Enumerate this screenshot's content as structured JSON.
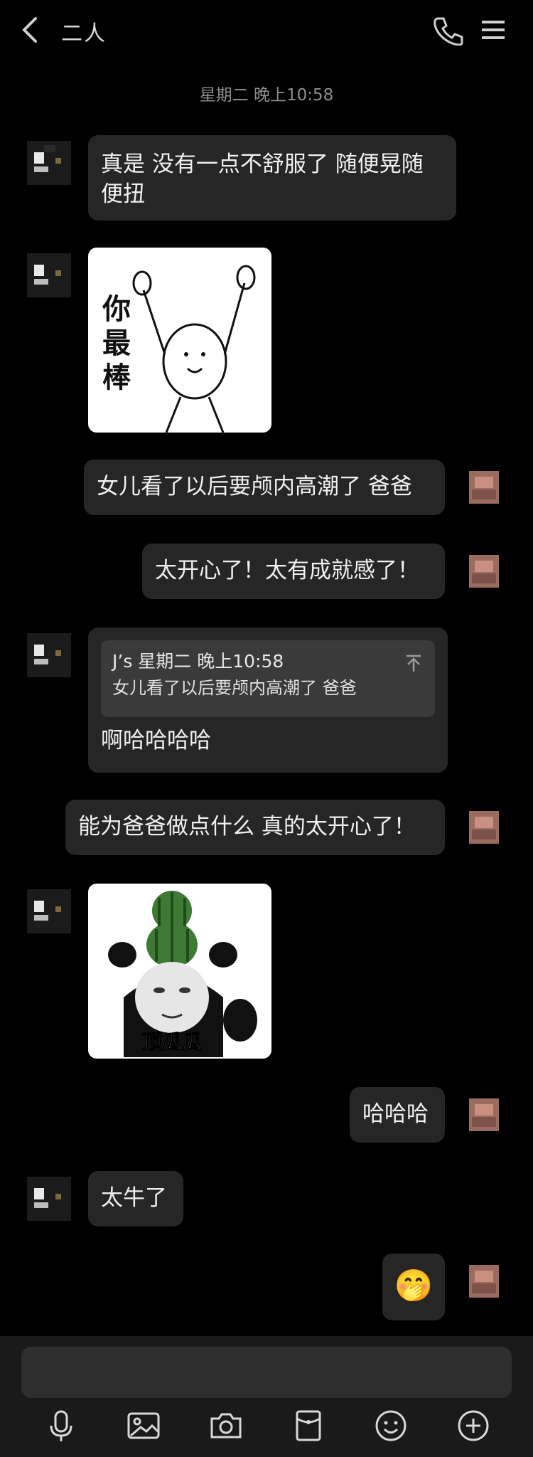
{
  "header": {
    "title": "二人"
  },
  "timestamp": "星期二 晚上10:58",
  "messages": {
    "m1": "真是 没有一点不舒服了 随便晃随便扭",
    "m1_line1": "真是 没有一点不舒服了 随便晃随",
    "m1_line2": "便扭",
    "sticker1_text": "你最棒",
    "sticker1_chars": [
      "你",
      "最",
      "棒"
    ],
    "m2": "女儿看了以后要颅内高潮了 爸爸",
    "m3": "太开心了！太有成就感了！",
    "quote_header": "J’s 星期二 晚上10:58",
    "quote_text": "女儿看了以后要颅内高潮了 爸爸",
    "m4": "啊哈哈哈哈",
    "m5": "能为爸爸做点什么 真的太开心了！",
    "sticker2_text": "顶瓜瓜",
    "m6": "哈哈哈",
    "m7": "太牛了",
    "m8_emoji": "🤭"
  },
  "toolbar": {
    "icons": [
      "microphone-icon",
      "image-icon",
      "camera-icon",
      "red-packet-icon",
      "emoji-icon",
      "plus-icon"
    ]
  },
  "colors": {
    "background": "#000000",
    "bubble": "#262626",
    "quote": "#3a3a3a",
    "muted_text": "#8e8e8e",
    "bottom_bar": "#1a1a1a"
  }
}
